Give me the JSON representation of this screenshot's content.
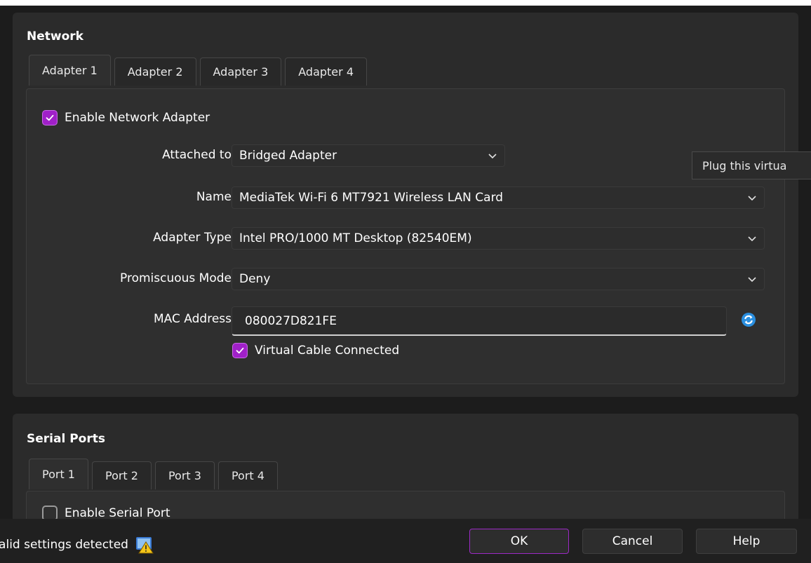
{
  "network": {
    "title": "Network",
    "tabs": [
      {
        "label": "Adapter 1",
        "active": true
      },
      {
        "label": "Adapter 2",
        "active": false
      },
      {
        "label": "Adapter 3",
        "active": false
      },
      {
        "label": "Adapter 4",
        "active": false
      }
    ],
    "enable_adapter": {
      "label": "Enable Network Adapter",
      "checked": true
    },
    "attached_to": {
      "label": "Attached to",
      "value": "Bridged Adapter"
    },
    "name": {
      "label": "Name",
      "value": "MediaTek Wi-Fi 6 MT7921 Wireless LAN Card"
    },
    "adapter_type": {
      "label": "Adapter Type",
      "value": "Intel PRO/1000 MT Desktop (82540EM)"
    },
    "promiscuous_mode": {
      "label": "Promiscuous Mode",
      "value": "Deny"
    },
    "mac_address": {
      "label": "MAC Address",
      "value": "080027D821FE"
    },
    "cable_connected": {
      "label": "Virtual Cable Connected",
      "checked": true
    },
    "tooltip": "Plug this virtua"
  },
  "serial": {
    "title": "Serial Ports",
    "tabs": [
      {
        "label": "Port 1",
        "active": true
      },
      {
        "label": "Port 2",
        "active": false
      },
      {
        "label": "Port 3",
        "active": false
      },
      {
        "label": "Port 4",
        "active": false
      }
    ],
    "enable_port": {
      "label": "Enable Serial Port",
      "checked": false
    }
  },
  "footer": {
    "status": "valid settings detected",
    "ok": "OK",
    "cancel": "Cancel",
    "help": "Help"
  },
  "colors": {
    "accent": "#a020c8",
    "background": "#1c1c1c",
    "section": "#2b2b2b",
    "refresh": "#2a8fe0",
    "warning": "#f5c518"
  },
  "icons": {
    "check": "check-icon",
    "chevron": "chevron-down-icon",
    "refresh": "refresh-icon",
    "warning": "warning-icon"
  }
}
